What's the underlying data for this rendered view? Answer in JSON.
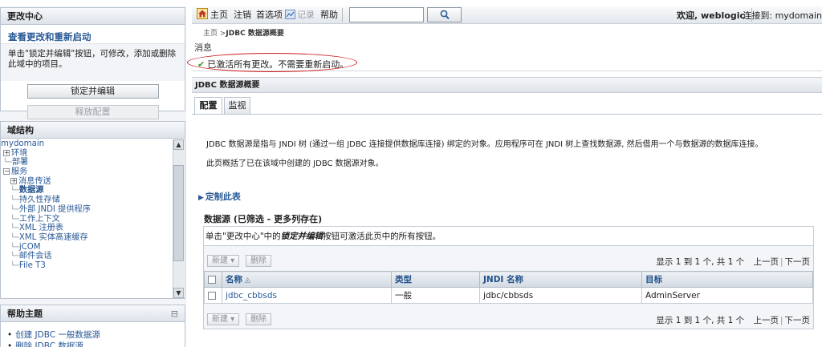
{
  "change_center": {
    "title": "更改中心",
    "subtitle": "查看更改和重新启动",
    "description": "单击\"锁定并编辑\"按钮，可修改，添加或删除此域中的项目。",
    "lock_button": "锁定并编辑",
    "release_button": "释放配置"
  },
  "domain_structure": {
    "title": "域结构",
    "items": [
      {
        "label": "mydomain",
        "conn": "",
        "pm": "",
        "bold": false
      },
      {
        "label": "环境",
        "conn": "",
        "pm": "+",
        "bold": false
      },
      {
        "label": "部署",
        "conn": "├",
        "pm": "",
        "bold": false
      },
      {
        "label": "服务",
        "conn": "",
        "pm": "−",
        "bold": false
      },
      {
        "label": "消息传送",
        "conn": " ├",
        "pm": "+",
        "bold": false
      },
      {
        "label": "数据源",
        "conn": " ├",
        "pm": "",
        "bold": true
      },
      {
        "label": "持久性存储",
        "conn": " ├",
        "pm": "",
        "bold": false
      },
      {
        "label": "外部 JNDI 提供程序",
        "conn": " ├",
        "pm": "",
        "bold": false
      },
      {
        "label": "工作上下文",
        "conn": " ├",
        "pm": "",
        "bold": false
      },
      {
        "label": "XML 注册表",
        "conn": " ├",
        "pm": "",
        "bold": false
      },
      {
        "label": "XML 实体高速缓存",
        "conn": " ├",
        "pm": "",
        "bold": false
      },
      {
        "label": "jCOM",
        "conn": " ├",
        "pm": "",
        "bold": false
      },
      {
        "label": "邮件会话",
        "conn": " ├",
        "pm": "",
        "bold": false
      },
      {
        "label": "File T3",
        "conn": " ├",
        "pm": "",
        "bold": false
      }
    ]
  },
  "help_topics": {
    "title": "帮助主题",
    "collapse": "⊟",
    "items": [
      "创建 JDBC 一般数据源",
      "删除 JDBC 数据源"
    ]
  },
  "toolbar": {
    "home": "主页",
    "logout": "注销",
    "preferences": "首选项",
    "record": "记录",
    "help": "帮助",
    "welcome": "欢迎, weblogic",
    "connected": "连接到: mydomain"
  },
  "breadcrumb": {
    "home": "主页",
    "sep": " >",
    "current": "JDBC 数据源概要"
  },
  "messages": {
    "title": "消息",
    "text": "已激活所有更改。不需要重新启动。"
  },
  "section": {
    "title": "JDBC 数据源概要"
  },
  "tabs": [
    {
      "label": "配置"
    },
    {
      "label": "监视"
    }
  ],
  "description": {
    "line1": "JDBC 数据源是指与 JNDI 树 (通过一组 JDBC 连接提供数据库连接) 绑定的对象。应用程序可在 JNDI 树上查找数据源, 然后借用一个与数据源的数据库连接。",
    "line2": "此页概括了已在该域中创建的 JDBC 数据源对象。"
  },
  "customize": "定制此表",
  "table": {
    "title": "数据源 (已筛选 - 更多列存在)",
    "note_before": "单击\"更改中心\"中的",
    "note_emphasis": "锁定并编辑",
    "note_after": "按钮可激活此页中的所有按钮。",
    "new_button": "新建 ▾",
    "delete_button": "删除",
    "pager_text": "显示 1 到 1 个, 共 1 个",
    "prev": "上一页",
    "next": "下一页",
    "columns": [
      "名称",
      "类型",
      "JNDI 名称",
      "目标"
    ],
    "rows": [
      {
        "name": "jdbc_cbbsds",
        "type": "一般",
        "jndi": "jdbc/cbbsds",
        "target": "AdminServer"
      }
    ]
  }
}
